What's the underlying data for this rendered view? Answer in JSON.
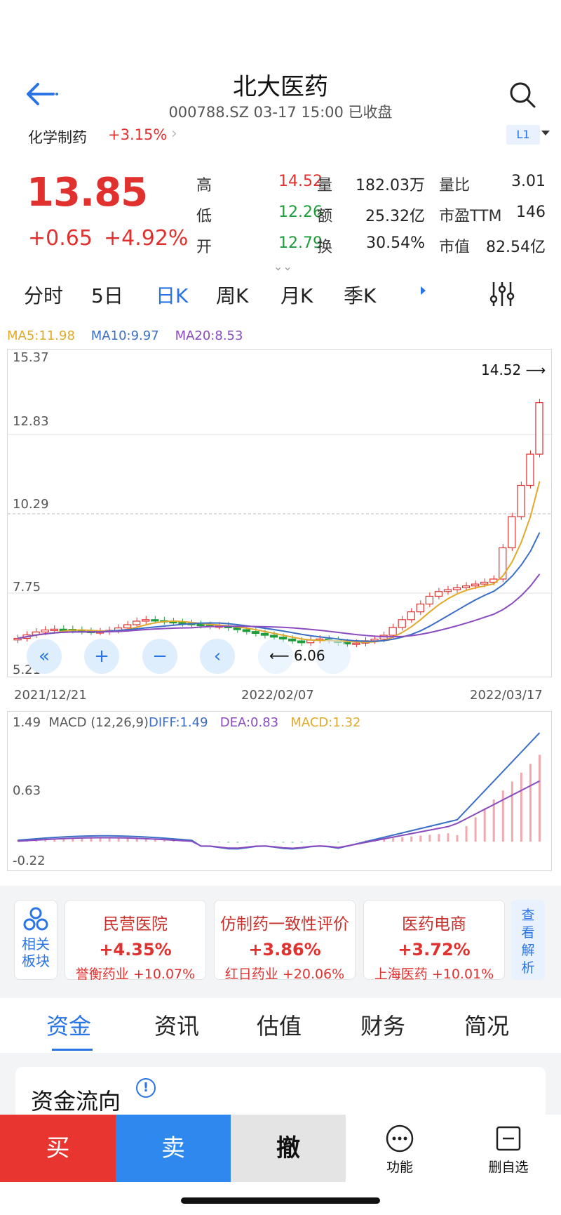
{
  "header": {
    "title": "北大医药",
    "subtitle": "000788.SZ 03-17 15:00 已收盘",
    "level": "L1"
  },
  "industry": {
    "name": "化学制药",
    "change": "+3.15%"
  },
  "quote": {
    "price": "13.85",
    "change": "+0.65",
    "change_pct": "+4.92%",
    "rows": [
      [
        {
          "label": "高",
          "value": "14.52",
          "color": "#e0312f"
        },
        {
          "label": "量",
          "value": "182.03万",
          "color": "#222"
        },
        {
          "label": "量比",
          "value": "3.01",
          "color": "#222"
        }
      ],
      [
        {
          "label": "低",
          "value": "12.26",
          "color": "#1e9e3a"
        },
        {
          "label": "额",
          "value": "25.32亿",
          "color": "#222"
        },
        {
          "label": "市盈TTM",
          "value": "146",
          "color": "#222"
        }
      ],
      [
        {
          "label": "开",
          "value": "12.79",
          "color": "#1e9e3a"
        },
        {
          "label": "换",
          "value": "30.54%",
          "color": "#222"
        },
        {
          "label": "市值",
          "value": "82.54亿",
          "color": "#222"
        }
      ]
    ]
  },
  "period_tabs": [
    "分时",
    "5日",
    "日K",
    "周K",
    "月K",
    "季K"
  ],
  "ma": {
    "ma5": "MA5:11.98",
    "ma10": "MA10:9.97",
    "ma20": "MA20:8.53",
    "colors": {
      "ma5": "#e0a92b",
      "ma10": "#3b6fc6",
      "ma20": "#8a4bbf"
    }
  },
  "kline": {
    "y_labels": [
      "15.37",
      "12.83",
      "10.29",
      "7.75",
      "5.21"
    ],
    "high_marker": "14.52",
    "low_marker": "6.06",
    "dates": [
      "2021/12/21",
      "2022/02/07",
      "2022/03/17"
    ]
  },
  "macd": {
    "title": "MACD (12,26,9)",
    "diff": "DIFF:1.49",
    "dea": "DEA:0.83",
    "macd": "MACD:1.32",
    "y_labels": [
      "1.49",
      "0.63",
      "-0.22"
    ]
  },
  "chart_data": {
    "type": "candlestick",
    "ylim": [
      5.21,
      15.37
    ],
    "x_range": [
      "2021/12/21",
      "2022/03/17"
    ],
    "recent_candles": [
      {
        "open": 12.79,
        "high": 14.52,
        "low": 12.26,
        "close": 13.85
      }
    ],
    "moving_averages": {
      "MA5": 11.98,
      "MA10": 9.97,
      "MA20": 8.53
    },
    "period_high": 14.52,
    "period_low": 6.06,
    "macd": {
      "DIFF": 1.49,
      "DEA": 0.83,
      "MACD": 1.32,
      "ylim": [
        -0.22,
        1.49
      ]
    }
  },
  "sectors": {
    "related_label": "相关板块",
    "cards": [
      {
        "name": "民营医院",
        "pct": "+4.35%",
        "stock": "誉衡药业 +10.07%"
      },
      {
        "name": "仿制药一致性评价",
        "pct": "+3.86%",
        "stock": "红日药业 +20.06%"
      },
      {
        "name": "医药电商",
        "pct": "+3.72%",
        "stock": "上海医药 +10.01%"
      }
    ],
    "view_label": "查看解析"
  },
  "bottom_tabs": [
    "资金",
    "资讯",
    "估值",
    "财务",
    "简况"
  ],
  "flow": {
    "title": "资金流向",
    "info": "!"
  },
  "actions": {
    "buy": "买",
    "sell": "卖",
    "cancel": "撤",
    "func": "功能",
    "watch": "删自选"
  }
}
